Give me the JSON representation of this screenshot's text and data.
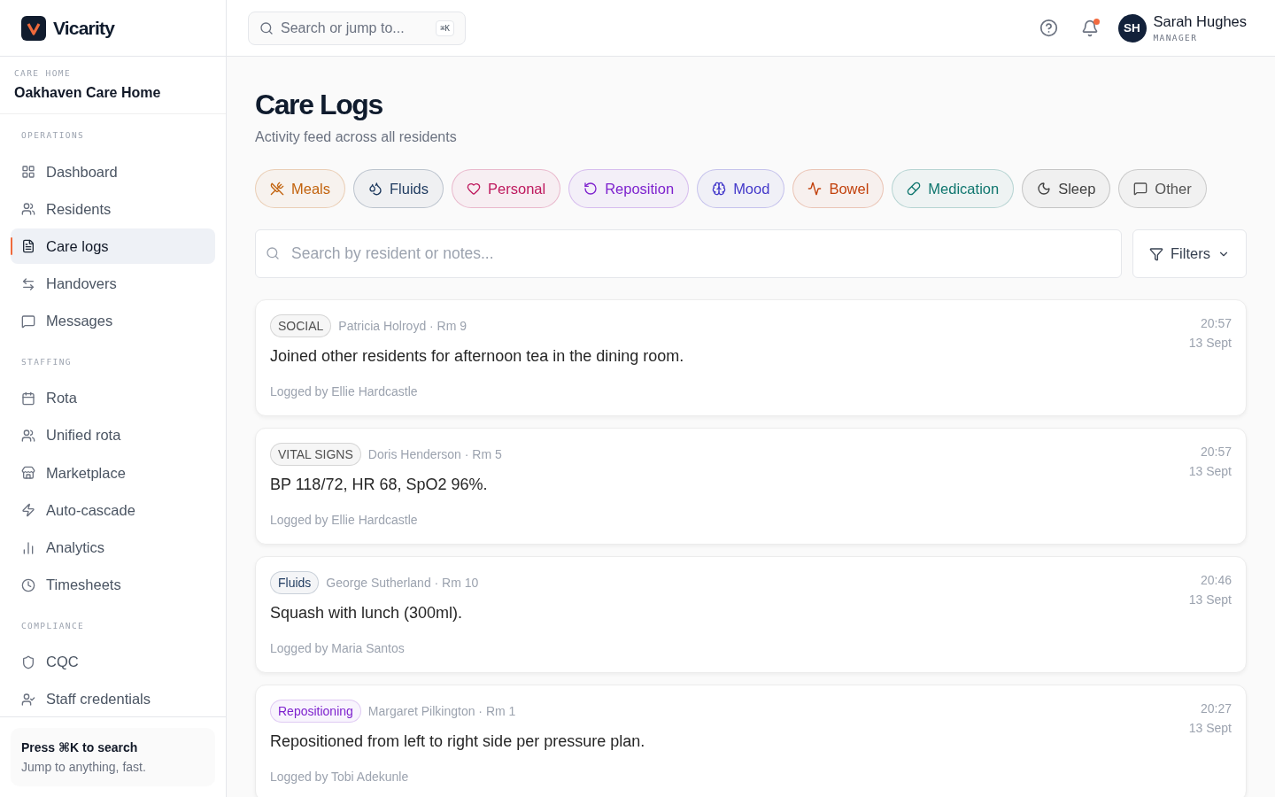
{
  "brand": {
    "name": "Vicarity"
  },
  "care_home": {
    "label": "CARE HOME",
    "name": "Oakhaven Care Home"
  },
  "sidebar": {
    "sections": [
      {
        "title": "OPERATIONS",
        "items": [
          {
            "label": "Dashboard",
            "selected": false
          },
          {
            "label": "Residents",
            "selected": false
          },
          {
            "label": "Care logs",
            "selected": true
          },
          {
            "label": "Handovers",
            "selected": false
          },
          {
            "label": "Messages",
            "selected": false
          }
        ]
      },
      {
        "title": "STAFFING",
        "items": [
          {
            "label": "Rota",
            "selected": false
          },
          {
            "label": "Unified rota",
            "selected": false
          },
          {
            "label": "Marketplace",
            "selected": false
          },
          {
            "label": "Auto-cascade",
            "selected": false
          },
          {
            "label": "Analytics",
            "selected": false
          },
          {
            "label": "Timesheets",
            "selected": false
          }
        ]
      },
      {
        "title": "COMPLIANCE",
        "items": [
          {
            "label": "CQC",
            "selected": false
          },
          {
            "label": "Staff credentials",
            "selected": false
          }
        ]
      }
    ]
  },
  "sidebar_tip": {
    "title": "Press ⌘K to search",
    "text": "Jump to anything, fast."
  },
  "topbar": {
    "search": {
      "placeholder": "Search or jump to...",
      "shortcut": "⌘K"
    },
    "notifications": {
      "unread": true
    },
    "user": {
      "initials": "SH",
      "name": "Sarah Hughes",
      "role": "MANAGER"
    }
  },
  "page": {
    "title": "Care Logs",
    "subtitle": "Activity feed across all residents"
  },
  "categories": [
    {
      "label": "Meals",
      "color": "#c2620c"
    },
    {
      "label": "Fluids",
      "color": "#1e3a5f"
    },
    {
      "label": "Personal",
      "color": "#be185d"
    },
    {
      "label": "Reposition",
      "color": "#7e22ce"
    },
    {
      "label": "Mood",
      "color": "#4338ca"
    },
    {
      "label": "Bowel",
      "color": "#c2410c"
    },
    {
      "label": "Medication",
      "color": "#0f766e"
    },
    {
      "label": "Sleep",
      "color": "#404040"
    },
    {
      "label": "Other",
      "color": "#525252"
    }
  ],
  "search": {
    "placeholder": "Search by resident or notes..."
  },
  "filters": {
    "label": "Filters"
  },
  "logs": [
    {
      "tag": {
        "label": "SOCIAL",
        "color": "#525252"
      },
      "resident": "Patricia Holroyd · Rm 9",
      "note": "Joined other residents for afternoon tea in the dining room.",
      "logged_by": "Logged by Ellie Hardcastle",
      "time": "20:57",
      "date": "13 Sept"
    },
    {
      "tag": {
        "label": "VITAL SIGNS",
        "color": "#525252"
      },
      "resident": "Doris Henderson · Rm 5",
      "note": "BP 118/72, HR 68, SpO2 96%.",
      "logged_by": "Logged by Ellie Hardcastle",
      "time": "20:57",
      "date": "13 Sept"
    },
    {
      "tag": {
        "label": "Fluids",
        "color": "#1e3a5f"
      },
      "resident": "George Sutherland · Rm 10",
      "note": "Squash with lunch (300ml).",
      "logged_by": "Logged by Maria Santos",
      "time": "20:46",
      "date": "13 Sept"
    },
    {
      "tag": {
        "label": "Repositioning",
        "color": "#7e22ce"
      },
      "resident": "Margaret Pilkington · Rm 1",
      "note": "Repositioned from left to right side per pressure plan.",
      "logged_by": "Logged by Tobi Adekunle",
      "time": "20:27",
      "date": "13 Sept"
    }
  ]
}
